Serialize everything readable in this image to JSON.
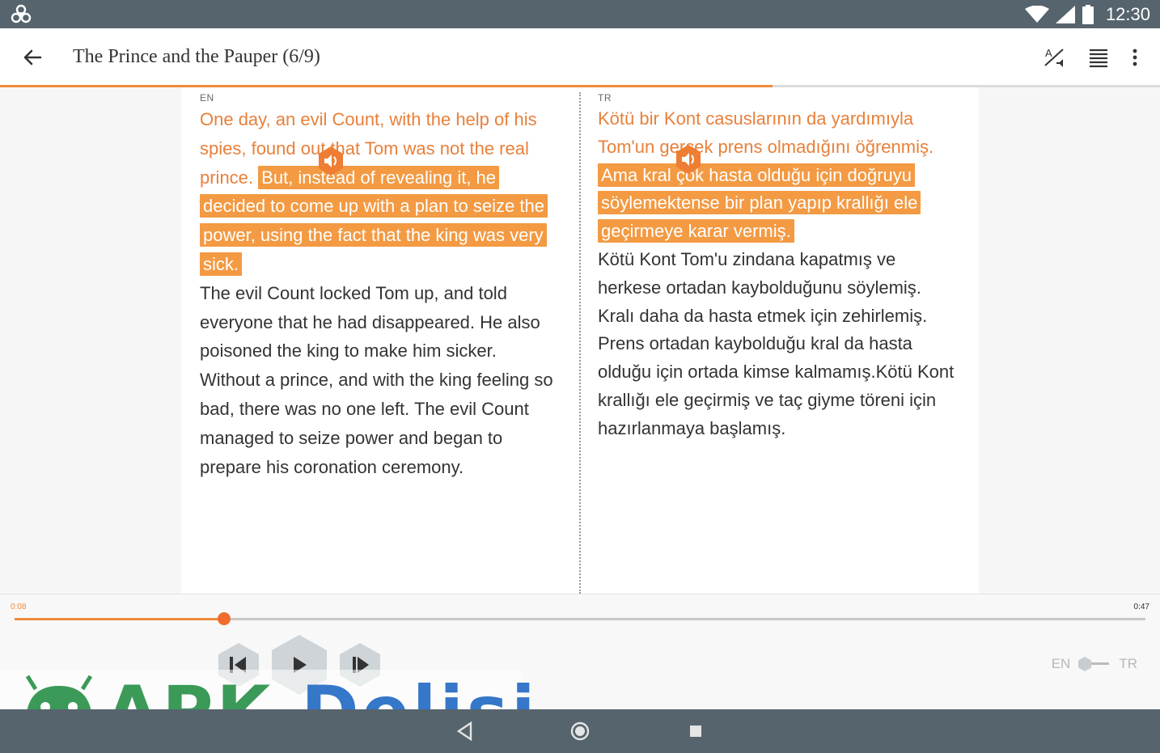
{
  "status_bar": {
    "time": "12:30",
    "icons": [
      "app-notification-icon",
      "wifi-icon",
      "signal-icon",
      "battery-icon"
    ]
  },
  "toolbar": {
    "title": "The Prince and the Pauper (6/9)",
    "icons": [
      "back-arrow-icon",
      "translate-settings-icon",
      "text-align-icon",
      "more-vert-icon"
    ]
  },
  "reading_progress": 0.666,
  "reader": {
    "left": {
      "lang": "EN",
      "read_text": "One day, an evil Count, with the help of his spies, found out that Tom was not the real prince.",
      "highlighted_text": "But, instead of revealing it, he decided to come up with a plan to seize the power, using the fact that the king was very sick.",
      "remaining_text": "The evil Count locked Tom up, and told everyone that he had disappeared. He also poisoned the king to make him sicker.    Without a prince, and with the king feeling so bad, there was no one left.      The evil Count managed to seize power and began to prepare his coronation ceremony."
    },
    "right": {
      "lang": "TR",
      "read_text": "Kötü bir Kont casuslarının da yardımıyla Tom'un gerçek prens olmadığını öğrenmiş.",
      "highlighted_text": "Ama kral çok hasta olduğu için doğruyu söylemektense bir plan yapıp krallığı ele geçirmeye karar vermiş.",
      "remaining_text": "Kötü Kont Tom'u zindana kapatmış ve herkese ortadan kaybolduğunu söylemiş.  Kralı daha da hasta etmek için zehirlemiş.     Prens ortadan kaybolduğu kral da hasta olduğu için ortada kimse kalmamış.Kötü Kont krallığı ele geçirmiş ve taç giyme töreni için hazırlanmaya başlamış."
    }
  },
  "player": {
    "current_time": "0:08",
    "total_time": "0:47",
    "position_fraction": 0.185,
    "controls": [
      "previous-sentence-icon",
      "play-icon",
      "next-sentence-icon"
    ],
    "lang_left": "EN",
    "lang_right": "TR"
  },
  "watermark": {
    "part1": "APK",
    "part2": "Delisi"
  },
  "colors": {
    "accent": "#ef8a3c",
    "highlight": "#f39a43",
    "bars": "#56646d"
  }
}
